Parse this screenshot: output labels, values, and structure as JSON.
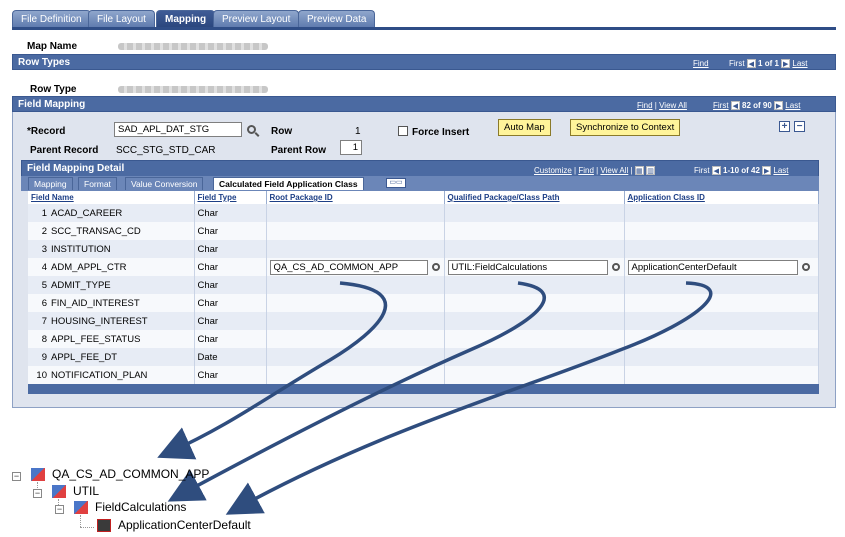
{
  "tabs": [
    "File Definition",
    "File Layout",
    "Mapping",
    "Preview Layout",
    "Preview Data"
  ],
  "map_name_label": "Map Name",
  "row_types": {
    "title": "Row Types",
    "find": "Find",
    "first": "First",
    "counter": "1 of 1",
    "last": "Last",
    "row_type_label": "Row Type"
  },
  "field_mapping": {
    "title": "Field Mapping",
    "find": "Find",
    "view_all": "View All",
    "first": "First",
    "counter": "82 of 90",
    "last": "Last",
    "record_label": "*Record",
    "record_value": "SAD_APL_DAT_STG",
    "row_label": "Row",
    "row_value": "1",
    "force_insert_label": "Force Insert",
    "auto_map": "Auto Map",
    "sync_context": "Synchronize to Context",
    "parent_record_label": "Parent Record",
    "parent_record_value": "SCC_STG_STD_CAR",
    "parent_row_label": "Parent Row",
    "parent_row_value": "1"
  },
  "detail": {
    "title": "Field Mapping Detail",
    "customize": "Customize",
    "find": "Find",
    "view_all": "View All",
    "first": "First",
    "counter": "1-10 of 42",
    "last": "Last",
    "subtabs": [
      "Mapping",
      "Format",
      "Value Conversion",
      "Calculated Field Application Class"
    ],
    "columns": [
      "Field Name",
      "Field Type",
      "Root Package ID",
      "Qualified Package/Class Path",
      "Application Class ID"
    ],
    "rows": [
      {
        "num": "1",
        "name": "ACAD_CAREER",
        "type": "Char"
      },
      {
        "num": "2",
        "name": "SCC_TRANSAC_CD",
        "type": "Char"
      },
      {
        "num": "3",
        "name": "INSTITUTION",
        "type": "Char"
      },
      {
        "num": "4",
        "name": "ADM_APPL_CTR",
        "type": "Char",
        "root": "QA_CS_AD_COMMON_APP",
        "path": "UTIL:FieldCalculations",
        "cls": "ApplicationCenterDefault"
      },
      {
        "num": "5",
        "name": "ADMIT_TYPE",
        "type": "Char"
      },
      {
        "num": "6",
        "name": "FIN_AID_INTEREST",
        "type": "Char"
      },
      {
        "num": "7",
        "name": "HOUSING_INTEREST",
        "type": "Char"
      },
      {
        "num": "8",
        "name": "APPL_FEE_STATUS",
        "type": "Char"
      },
      {
        "num": "9",
        "name": "APPL_FEE_DT",
        "type": "Date"
      },
      {
        "num": "10",
        "name": "NOTIFICATION_PLAN",
        "type": "Char"
      }
    ]
  },
  "tree": {
    "root": "QA_CS_AD_COMMON_APP",
    "package": "UTIL",
    "subpackage": "FieldCalculations",
    "class": "ApplicationCenterDefault"
  },
  "colors": {
    "header_bar": "#4b6aa2",
    "panel_bg": "#dfe4ee",
    "button_yellow": "#fff49a",
    "arrow": "#2f4d7e"
  }
}
